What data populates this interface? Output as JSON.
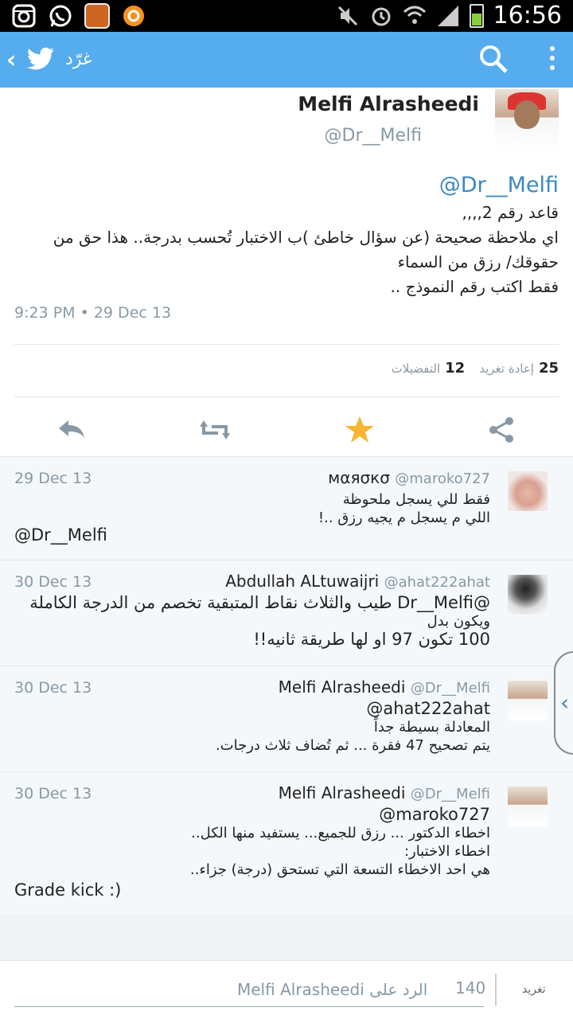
{
  "status_bar": {
    "time": "16:56",
    "left_icons": [
      "instagram-icon",
      "whatsapp-icon",
      "app-thumbnail-icon",
      "circle-app-icon"
    ],
    "right_icons": [
      "mute-icon",
      "alarm-icon",
      "wifi-icon",
      "signal-icon",
      "battery-icon"
    ]
  },
  "app_bar": {
    "title": "غرّد",
    "back_icon": "chevron-left-icon",
    "logo_icon": "twitter-bird-icon",
    "search_icon": "search-icon",
    "menu_icon": "overflow-menu-icon",
    "color": "#55acee"
  },
  "main_tweet": {
    "author_name": "Melfi Alrasheedi",
    "author_handle": "@Dr__Melfi",
    "mention": "@Dr__Melfi",
    "lines": [
      "قاعد رقم 2,,,,",
      "اي ملاحظة صحيحة (عن سؤال خاطئ )ب الاختبار تُحسب بدرجة.. هذا حق من",
      "حقوقك/ رزق من السماء",
      "فقط اكتب رقم النموذج .."
    ],
    "timestamp": "9:23 PM • 29 Dec 13",
    "retweets_count": "25",
    "retweets_label": "إعادة تغريد",
    "favorites_count": "12",
    "favorites_label": "التفضيلات",
    "actions": [
      "reply-icon",
      "retweet-icon",
      "favorite-icon",
      "share-icon"
    ]
  },
  "replies": [
    {
      "name": "мαяσкσ",
      "handle": "@maroko727",
      "date": "29 Dec 13",
      "lines": [
        "فقط للي يسجل ملحوظة",
        "اللي م يسجل م يجيه رزق ..!"
      ],
      "extra": "@Dr__Melfi"
    },
    {
      "name": "Abdullah ALtuwaijri",
      "handle": "@ahat222ahat",
      "date": "30 Dec 13",
      "lines": [
        "@Dr__Melfi طيب والثلاث نقاط المتبقية تخصم من الدرجة الكاملة",
        "ويكون بدل",
        "100 تكون 97 او لها طريقة ثانيه!!"
      ],
      "extra": ""
    },
    {
      "name": "Melfi Alrasheedi",
      "handle": "@Dr__Melfi",
      "date": "30 Dec 13",
      "lines": [
        "@ahat222ahat",
        "المعادلة بسيطة جداً",
        "يتم تصحيح 47 فقرة ... ثم تُضاف ثلاث درجات."
      ],
      "extra": ""
    },
    {
      "name": "Melfi Alrasheedi",
      "handle": "@Dr__Melfi",
      "date": "30 Dec 13",
      "lines": [
        "@maroko727",
        "اخطاء الدكتور ... رزق للجميع... يستفيد منها الكل..",
        "اخطاء الاختبار:",
        "هي احد الاخطاء التسعة التي تستحق (درجة) جزاء.."
      ],
      "extra": "Grade kick :)"
    }
  ],
  "compose": {
    "placeholder": "الرد على Melfi Alrasheedi",
    "char_count": "140",
    "send_label": "تغريد"
  },
  "accent_color": "#3b88c3",
  "favorite_color": "#f5b731"
}
